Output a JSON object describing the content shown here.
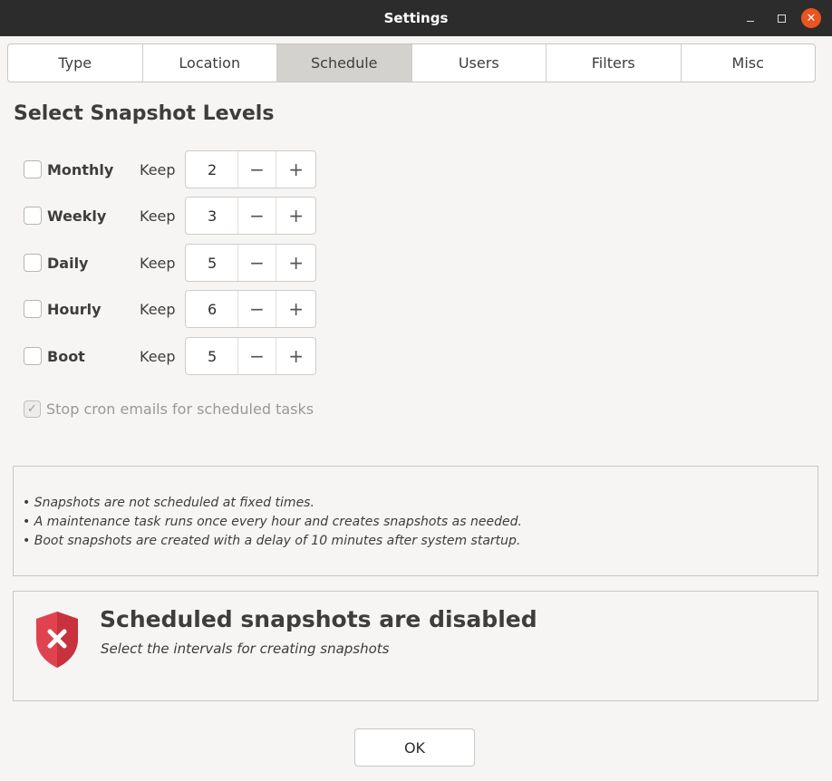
{
  "window": {
    "title": "Settings",
    "minimize_icon": "minimize-icon",
    "maximize_icon": "maximize-icon",
    "close_icon": "close-icon",
    "close_glyph": "✕"
  },
  "tabs": [
    {
      "label": "Type",
      "active": false
    },
    {
      "label": "Location",
      "active": false
    },
    {
      "label": "Schedule",
      "active": true
    },
    {
      "label": "Users",
      "active": false
    },
    {
      "label": "Filters",
      "active": false
    },
    {
      "label": "Misc",
      "active": false
    }
  ],
  "heading": "Select Snapshot Levels",
  "levels": [
    {
      "name": "Monthly",
      "checked": false,
      "keep_label": "Keep",
      "value": "2",
      "minus": "−",
      "plus": "+"
    },
    {
      "name": "Weekly",
      "checked": false,
      "keep_label": "Keep",
      "value": "3",
      "minus": "−",
      "plus": "+"
    },
    {
      "name": "Daily",
      "checked": false,
      "keep_label": "Keep",
      "value": "5",
      "minus": "−",
      "plus": "+"
    },
    {
      "name": "Hourly",
      "checked": false,
      "keep_label": "Keep",
      "value": "6",
      "minus": "−",
      "plus": "+"
    },
    {
      "name": "Boot",
      "checked": false,
      "keep_label": "Keep",
      "value": "5",
      "minus": "−",
      "plus": "+"
    }
  ],
  "cron": {
    "label": "Stop cron emails for scheduled tasks",
    "checked": true,
    "disabled": true,
    "check_glyph": "✓"
  },
  "notes": [
    "• Snapshots are not scheduled at fixed times.",
    "• A maintenance task runs once every hour and creates snapshots as needed.",
    "• Boot snapshots are created with a delay of 10 minutes after system startup."
  ],
  "status": {
    "icon": "shield-error-icon",
    "title": "Scheduled snapshots are disabled",
    "subtitle": "Select the intervals for creating snapshots",
    "color": "#e0434f"
  },
  "ok_button": "OK",
  "colors": {
    "titlebar": "#2c2c2c",
    "close_button": "#e95420",
    "active_tab": "#d4d2cf",
    "background": "#f6f5f4"
  }
}
